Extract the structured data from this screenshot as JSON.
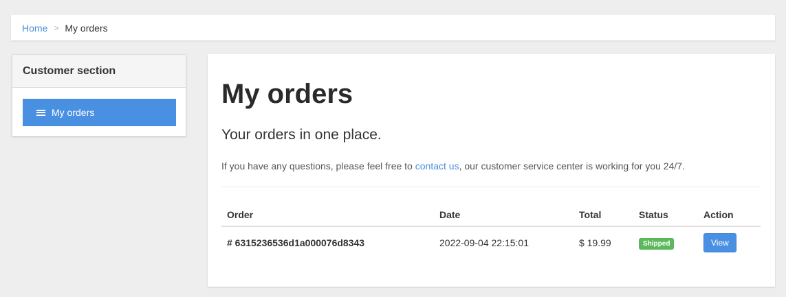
{
  "breadcrumb": {
    "home": "Home",
    "separator": ">",
    "current": "My orders"
  },
  "sidebar": {
    "title": "Customer section",
    "items": [
      {
        "label": "My orders",
        "icon": "list-icon",
        "active": true
      }
    ]
  },
  "main": {
    "title": "My orders",
    "lead": "Your orders in one place.",
    "help_prefix": "If you have any questions, please feel free to ",
    "help_link": "contact us",
    "help_suffix": ", our customer service center is working for you 24/7.",
    "table": {
      "headers": [
        "Order",
        "Date",
        "Total",
        "Status",
        "Action"
      ],
      "rows": [
        {
          "order": "# 6315236536d1a000076d8343",
          "date": "2022-09-04 22:15:01",
          "total": "$ 19.99",
          "status": "Shipped",
          "action": "View"
        }
      ]
    }
  },
  "colors": {
    "accent": "#4a90e2",
    "status_shipped": "#5cb85c",
    "background": "#eeeeee"
  }
}
